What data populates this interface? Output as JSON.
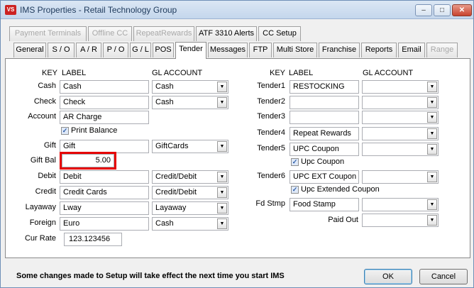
{
  "window": {
    "title": "IMS Properties - Retail Technology Group",
    "icon": "VS",
    "minimize": "–",
    "maximize": "□",
    "close": "✕"
  },
  "tabs_row1": [
    "Payment Terminals",
    "Offline CC",
    "RepeatRewards",
    "ATF 3310 Alerts",
    "CC Setup"
  ],
  "tabs_row2": [
    "General",
    "S / O",
    "A / R",
    "P / O",
    "G / L",
    "POS",
    "Tender",
    "Messages",
    "FTP",
    "Multi Store",
    "Franchise",
    "Reports",
    "Email",
    "Range"
  ],
  "headers": {
    "key": "KEY",
    "label": "LABEL",
    "gl": "GL ACCOUNT"
  },
  "left": [
    {
      "key": "Cash",
      "label": "Cash",
      "gl": "Cash"
    },
    {
      "key": "Check",
      "label": "Check",
      "gl": "Cash"
    },
    {
      "key": "Account",
      "label": "AR Charge"
    },
    {
      "key": "Gift",
      "label": "Gift",
      "gl": "GiftCards"
    },
    {
      "key": "Gift Bal",
      "label": "5.00"
    },
    {
      "key": "Debit",
      "label": "Debit",
      "gl": "Credit/Debit"
    },
    {
      "key": "Credit",
      "label": "Credit Cards",
      "gl": "Credit/Debit"
    },
    {
      "key": "Layaway",
      "label": "Lway",
      "gl": "Layaway"
    },
    {
      "key": "Foreign",
      "label": "Euro",
      "gl": "Cash"
    },
    {
      "key": "Cur Rate",
      "label": "123.123456"
    }
  ],
  "print_balance": "Print Balance",
  "right": [
    {
      "key": "Tender1",
      "label": "RESTOCKING",
      "gl": ""
    },
    {
      "key": "Tender2",
      "label": "",
      "gl": ""
    },
    {
      "key": "Tender3",
      "label": "",
      "gl": ""
    },
    {
      "key": "Tender4",
      "label": "Repeat Rewards",
      "gl": ""
    },
    {
      "key": "Tender5",
      "label": "UPC Coupon",
      "gl": ""
    },
    {
      "key": "Tender6",
      "label": "UPC EXT Coupon",
      "gl": ""
    },
    {
      "key": "Fd Stmp",
      "label": "Food Stamp",
      "gl": ""
    }
  ],
  "upc_coupon": "Upc Coupon",
  "upc_ext": "Upc Extended Coupon",
  "paid_out": {
    "label": "Paid Out",
    "value": ""
  },
  "footer": {
    "message": "Some changes made to Setup will take effect the next time you start IMS",
    "ok": "OK",
    "cancel": "Cancel"
  },
  "icons": {
    "combo_arrow": "▼",
    "checkmark": "✓"
  }
}
